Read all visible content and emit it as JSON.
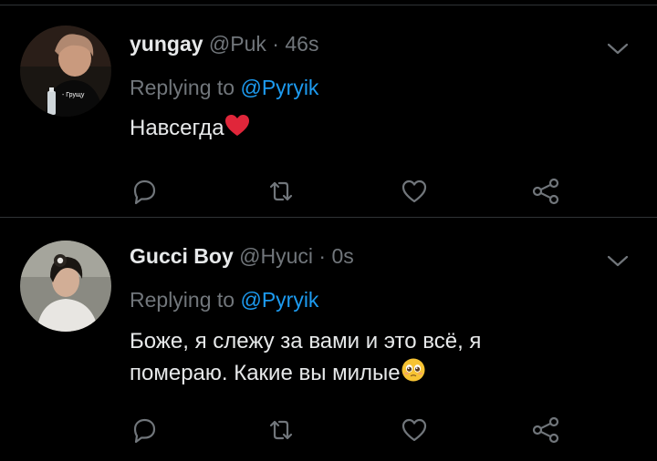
{
  "tweets": [
    {
      "display_name": "yungay",
      "handle": "@Puk",
      "separator": "·",
      "time": "46s",
      "reply_prefix": "Replying to",
      "reply_handle": "@Pyryik",
      "text": "Навсегда",
      "avatar_caption": "- Грущу",
      "emoji_icon": "red-heart-emoji"
    },
    {
      "display_name": "Gucci Boy",
      "handle": "@Hyuci",
      "separator": "·",
      "time": "0s",
      "reply_prefix": "Replying to",
      "reply_handle": "@Pyryik",
      "text_line_1": "Боже, я слежу за вами и это всё, я",
      "text_line_2": "помераю. Какие вы милые",
      "emoji_icon": "pleading-face-emoji"
    }
  ],
  "colors": {
    "background": "#000000",
    "divider": "#2f3336",
    "secondary_text": "#71767b",
    "link": "#1d9bf0",
    "primary_text": "#e7e9ea"
  },
  "action_icons": [
    "reply-icon",
    "retweet-icon",
    "like-icon",
    "share-icon"
  ]
}
